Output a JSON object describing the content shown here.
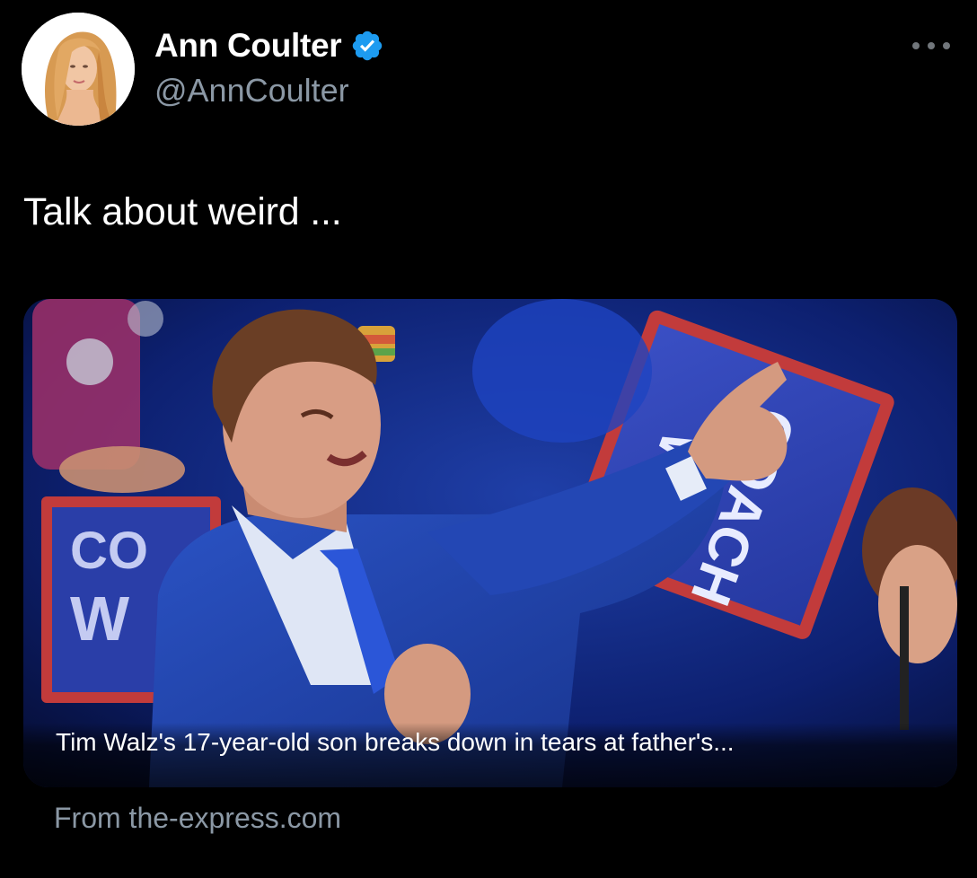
{
  "author": {
    "display_name": "Ann Coulter",
    "handle": "@AnnCoulter",
    "verified": true,
    "avatar_icon": "profile-photo"
  },
  "menu": {
    "icon": "more-horizontal-icon"
  },
  "tweet": {
    "text": "Talk about weird ..."
  },
  "link_card": {
    "image_icon": "photo-crying-young-man-pointing",
    "headline": "Tim Walz's 17-year-old son breaks down in tears at father's...",
    "source": "From the-express.com"
  },
  "colors": {
    "background": "#000000",
    "primary_text": "#ffffff",
    "secondary_text": "#8b98a5",
    "verified_badge": "#1d9bf0"
  }
}
